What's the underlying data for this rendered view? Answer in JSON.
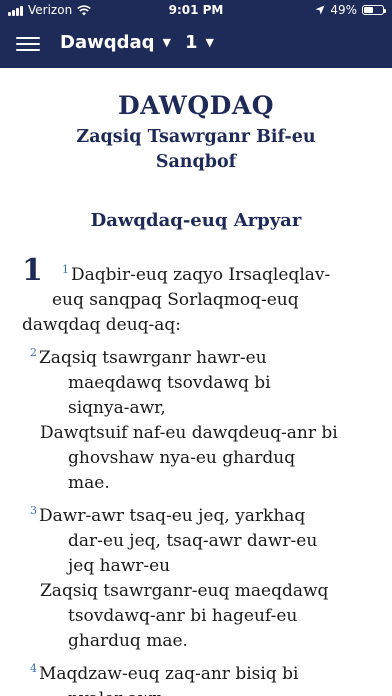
{
  "status_bar": {
    "carrier": "Verizon",
    "time": "9:01 PM",
    "battery_percent": "49%",
    "battery_level": 0.49,
    "icons": [
      "signal-icon",
      "wifi-icon",
      "location-arrow-icon",
      "battery-icon"
    ]
  },
  "nav": {
    "menu_icon": "hamburger-icon",
    "book": "Dawqdaq",
    "chapter": "1",
    "caret": "▼",
    "background_color": "#1e2a57"
  },
  "content": {
    "book_title": "DAWQDAQ",
    "book_subtitle": "Zaqsiq Tsawrganr Bif-eu Sanqbof",
    "section_heading": "Dawqdaq-euq Arpyar",
    "chapter_number": "1",
    "lines": [
      {
        "verse": "1",
        "text": "Daqbir-euq zaqyo Irsaqleqlav-"
      },
      {
        "verse": "",
        "text": "euq sanqpaq Sorlaqmoq-euq"
      },
      {
        "verse": "",
        "text": "dawqdaq deuq-aq:"
      },
      {
        "verse": "2",
        "text": "Zaqsiq tsawrganr hawr-eu"
      },
      {
        "verse": "",
        "text": "maeqdawq tsovdawq bi"
      },
      {
        "verse": "",
        "text": "siqnya-awr,"
      },
      {
        "verse": "",
        "text": "Dawqtsuif naf-eu dawqdeuq-anr bi"
      },
      {
        "verse": "",
        "text": "ghovshaw nya-eu gharduq"
      },
      {
        "verse": "",
        "text": "mae."
      },
      {
        "verse": "3",
        "text": "Dawr-awr tsaq-eu jeq, yarkhaq"
      },
      {
        "verse": "",
        "text": "dar-eu jeq, tsaq-awr dawr-eu"
      },
      {
        "verse": "",
        "text": "jeq hawr-eu"
      },
      {
        "verse": "",
        "text": "Zaqsiq tsawrganr-euq maeqdawq"
      },
      {
        "verse": "",
        "text": "tsovdawq-anr bi hageuf-eu"
      },
      {
        "verse": "",
        "text": "gharduq mae."
      },
      {
        "verse": "4",
        "text": "Maqdzaw-euq zaq-anr bisiq bi"
      },
      {
        "verse": "",
        "text": "nyaler awr"
      }
    ],
    "text_color": "#1a1a1a",
    "heading_color": "#1e2a57",
    "verse_number_color": "#3a74b8"
  }
}
